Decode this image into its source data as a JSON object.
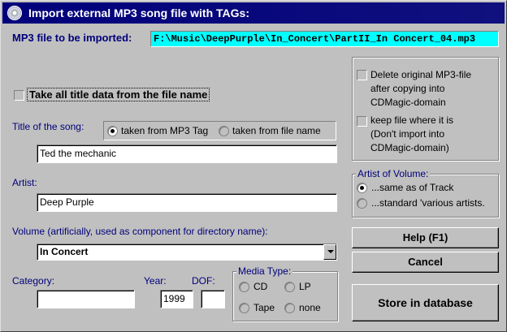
{
  "window": {
    "title": "Import external MP3 song file with TAGs:"
  },
  "mp3file": {
    "label": "MP3 file to be imported:",
    "path": "F:\\Music\\DeepPurple\\In_Concert\\PartII_In Concert_04.mp3"
  },
  "take_all": {
    "label": "Take all title data from the file name",
    "checked": false
  },
  "title": {
    "label": "Title of the song:",
    "option_tag": "taken from MP3 Tag",
    "option_file": "taken from file name",
    "selected": "tag",
    "value": "Ted the mechanic"
  },
  "artist": {
    "label": "Artist:",
    "value": "Deep Purple"
  },
  "volume": {
    "label": "Volume (artificially, used as component for directory name):",
    "value": "In Concert"
  },
  "category": {
    "label": "Category:",
    "value": ""
  },
  "year": {
    "label": "Year:",
    "value": "1999"
  },
  "dof": {
    "label": "DOF:",
    "value": ""
  },
  "media_type": {
    "label": "Media Type:",
    "options": [
      "CD",
      "LP",
      "Tape",
      "none"
    ]
  },
  "options_panel": {
    "delete_label_1": "Delete original MP3-file",
    "delete_label_2": "after copying into",
    "delete_label_3": "CDMagic-domain",
    "keep_label_1": "keep file where it is",
    "keep_label_2": "(Don't import into",
    "keep_label_3": "CDMagic-domain)"
  },
  "artist_of_volume": {
    "label": "Artist of Volume:",
    "option_same": "...same as of Track",
    "option_various": "...standard 'various artists."
  },
  "buttons": {
    "help": "Help (F1)",
    "cancel": "Cancel",
    "store": "Store in database"
  },
  "colors": {
    "titlebar": "#00007b",
    "path_field_bg": "#00ffff",
    "label_blue": "#00007b",
    "window_bg": "#c0c0c0"
  }
}
